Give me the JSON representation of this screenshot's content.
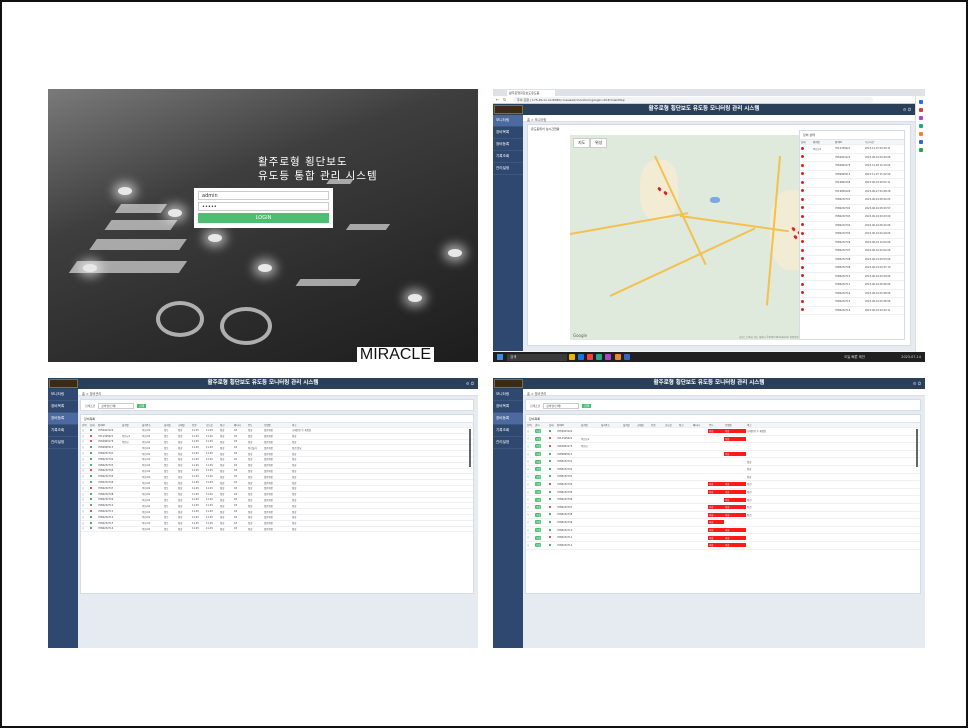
{
  "login": {
    "title_line1": "활주로형 횡단보도",
    "title_line2": "유도등 통합 관리 시스템",
    "username_value": "admin",
    "password_value": "•••••",
    "login_button": "LOGIN",
    "brand": "MIRACLE"
  },
  "app": {
    "title": "활주로형 횡단보도 유도등 모니터링 관리 시스템",
    "sidebar": [
      "모니터링",
      "장비목록",
      "장비등록",
      "기록조회",
      "관리설정"
    ]
  },
  "browser": {
    "tab_title": "활주로형횡단보도유도등",
    "url": "주의 요함 | 175.46.xx.xx:8080/crosswalk/monitoring/login.ctrl#/mainMap",
    "taskbar_search": "검색",
    "taskbar_weather": "오늘 빠른 제안",
    "taskbar_time": "2023-07-14",
    "map_tabs": [
      "지도",
      "위성"
    ],
    "map_card_title": "유도등위치 실시간현황",
    "google": "Google",
    "map_footer": "키보드 단축키  지도 데이터 ©2023 SK telecom  이용약관  지도 오류 신고",
    "status_title": "장비 상태",
    "status_headers": [
      "상태",
      "장비명",
      "장비ID",
      "수신시간"
    ],
    "status_rows": [
      {
        "color": "#d22",
        "name": "옥천교1",
        "id": "7012345621",
        "time": "2023-12-07 09:30:11"
      },
      {
        "color": "#d22",
        "name": "",
        "id": "7056923124",
        "time": "2023-06-19 09:44:06"
      },
      {
        "color": "#d22",
        "name": "",
        "id": "7084963175",
        "time": "2023-12-28 10:14:04"
      },
      {
        "color": "#d22",
        "name": "",
        "id": "7089965513",
        "time": "2023-11-07 15:22:09"
      },
      {
        "color": "#d22",
        "name": "",
        "id": "7019862106",
        "time": "2023-06-19 08:52:11"
      },
      {
        "color": "#d22",
        "name": "",
        "id": "7019856109",
        "time": "2023-06-27 09:48:28"
      },
      {
        "color": "#d22",
        "name": "",
        "id": "7086232701",
        "time": "2023-06-19 08:44:05"
      },
      {
        "color": "#d22",
        "name": "",
        "id": "7086232702",
        "time": "2023-06-19 08:43:57"
      },
      {
        "color": "#d22",
        "name": "",
        "id": "7086232703",
        "time": "2023-06-19 09:23:09"
      },
      {
        "color": "#d22",
        "name": "",
        "id": "7086232704",
        "time": "2023-06-19 08:44:06"
      },
      {
        "color": "#d22",
        "name": "",
        "id": "7086232705",
        "time": "2023-06-19 09:29:06"
      },
      {
        "color": "#d22",
        "name": "",
        "id": "7086232706",
        "time": "2023-06-19 10:04:06"
      },
      {
        "color": "#d22",
        "name": "",
        "id": "7086232707",
        "time": "2023-06-19 09:52:06"
      },
      {
        "color": "#d22",
        "name": "",
        "id": "7086232708",
        "time": "2023-06-19 09:53:06"
      },
      {
        "color": "#d22",
        "name": "",
        "id": "7086232709",
        "time": "2023-06-19 09:37:10"
      },
      {
        "color": "#d22",
        "name": "",
        "id": "7086232710",
        "time": "2023-06-19 09:49:06"
      },
      {
        "color": "#d22",
        "name": "",
        "id": "7086232711",
        "time": "2023-06-19 08:46:06"
      },
      {
        "color": "#d22",
        "name": "",
        "id": "7086232712",
        "time": "2023-06-19 09:48:06"
      },
      {
        "color": "#d22",
        "name": "",
        "id": "7086232713",
        "time": "2023-06-19 09:36:06"
      },
      {
        "color": "#d22",
        "name": "",
        "id": "7086232714",
        "time": "2023-06-19 09:44:11"
      }
    ]
  },
  "list": {
    "breadcrumb": "홈 > 장비관리",
    "search_label": "검색조건",
    "search_select": "장비명(전체)",
    "search_button": "검색",
    "card_title": "장비목록",
    "headers": [
      "선택",
      "상태",
      "장비ID",
      "설치명",
      "설치주소",
      "설치일",
      "교체일",
      "전원",
      "조도값",
      "통신",
      "배터리",
      "온도",
      "모델명",
      "비고"
    ],
    "rows": [
      [
        "",
        "#2a8d3c",
        "7056923124",
        "",
        "옥천-01",
        "점등",
        "정상",
        "11.0V",
        "11.0V",
        "정상",
        "18",
        "정상",
        "일반제품",
        "교체완료 후 재점검"
      ],
      [
        "",
        "#d22",
        "7012345621",
        "옥천교1",
        "옥천-01",
        "점등",
        "정상",
        "11.0V",
        "11.0V",
        "정상",
        "18",
        "정상",
        "일반제품",
        "정상"
      ],
      [
        "",
        "#d22",
        "7084963175",
        "옥천교",
        "옥천-01",
        "점등",
        "정상",
        "11.0V",
        "11.0V",
        "정상",
        "18",
        "정상",
        "일반제품",
        "정상"
      ],
      [
        "",
        "#2a8d3c",
        "7089965513",
        "",
        "옥천-01",
        "점등",
        "정상",
        "11.0V",
        "11.0V",
        "정상",
        "18",
        "통신불가",
        "일반제품",
        "점검 필요"
      ],
      [
        "",
        "#2a8d3c",
        "7086232701",
        "",
        "옥천-01",
        "점등",
        "정상",
        "11.0V",
        "11.0V",
        "정상",
        "18",
        "정상",
        "일반제품",
        "정상"
      ],
      [
        "",
        "#2a8d3c",
        "7086232702",
        "",
        "옥천-01",
        "점등",
        "정상",
        "11.0V",
        "11.0V",
        "정상",
        "18",
        "정상",
        "일반제품",
        "정상"
      ],
      [
        "",
        "#2a8d3c",
        "7086232703",
        "",
        "옥천-01",
        "점등",
        "정상",
        "11.0V",
        "11.0V",
        "정상",
        "18",
        "정상",
        "일반제품",
        "정상"
      ],
      [
        "",
        "#d22",
        "7086232704",
        "",
        "옥천-01",
        "점등",
        "정상",
        "11.0V",
        "11.0V",
        "정상",
        "18",
        "정상",
        "일반제품",
        "정상"
      ],
      [
        "",
        "#2a8d3c",
        "7086232705",
        "",
        "옥천-01",
        "점등",
        "정상",
        "11.0V",
        "11.0V",
        "정상",
        "18",
        "정상",
        "일반제품",
        "정상"
      ],
      [
        "",
        "#2a8d3c",
        "7086232706",
        "",
        "옥천-01",
        "점등",
        "정상",
        "11.0V",
        "11.0V",
        "정상",
        "18",
        "정상",
        "일반제품",
        "정상"
      ],
      [
        "",
        "#d22",
        "7086232707",
        "",
        "옥천-01",
        "점등",
        "정상",
        "11.0V",
        "11.0V",
        "정상",
        "18",
        "정상",
        "일반제품",
        "정상"
      ],
      [
        "",
        "#2a8d3c",
        "7086232708",
        "",
        "옥천-01",
        "점등",
        "정상",
        "11.0V",
        "11.0V",
        "정상",
        "18",
        "정상",
        "일반제품",
        "정상"
      ],
      [
        "",
        "#2a8d3c",
        "7086232709",
        "",
        "옥천-01",
        "점등",
        "정상",
        "11.0V",
        "11.0V",
        "정상",
        "18",
        "정상",
        "일반제품",
        "정상"
      ],
      [
        "",
        "#2a8d3c",
        "7086232710",
        "",
        "옥천-01",
        "점등",
        "정상",
        "11.0V",
        "11.0V",
        "정상",
        "18",
        "정상",
        "일반제품",
        "정상"
      ],
      [
        "",
        "#d22",
        "7086232711",
        "",
        "옥천-01",
        "점등",
        "정상",
        "11.0V",
        "11.0V",
        "정상",
        "18",
        "정상",
        "일반제품",
        "정상"
      ],
      [
        "",
        "#2a8d3c",
        "7086232712",
        "",
        "옥천-01",
        "점등",
        "정상",
        "11.0V",
        "11.0V",
        "정상",
        "18",
        "정상",
        "일반제품",
        "정상"
      ],
      [
        "",
        "#2a8d3c",
        "7086232713",
        "",
        "옥천-01",
        "점등",
        "정상",
        "11.0V",
        "11.0V",
        "정상",
        "18",
        "정상",
        "일반제품",
        "정상"
      ],
      [
        "",
        "#2a8d3c",
        "7086232714",
        "",
        "옥천-01",
        "점등",
        "정상",
        "11.0V",
        "11.0V",
        "정상",
        "18",
        "정상",
        "일반제품",
        "정상"
      ]
    ]
  },
  "list2": {
    "breadcrumb": "홈 > 장비관리",
    "search_label": "검색조건",
    "search_select": "장비명(전체)",
    "search_button": "검색",
    "card_title": "장비목록",
    "tag": "수정",
    "headers": [
      "선택",
      "관리",
      "상태",
      "장비ID",
      "설치명",
      "설치주소",
      "설치일",
      "교체일",
      "전원",
      "조도값",
      "통신",
      "배터리",
      "온도",
      "모델명",
      "비고"
    ],
    "rows": [
      {
        "color": "#2a8d3c",
        "id": "7056923124",
        "name": "",
        "r1": "이상",
        "r2": "이상",
        "note": "교체완료 후 재점검"
      },
      {
        "color": "#d22",
        "id": "7012345621",
        "name": "옥천교1",
        "r1": "",
        "r2": "이상",
        "note": ""
      },
      {
        "color": "#d22",
        "id": "7084963175",
        "name": "옥천교",
        "r1": "",
        "r2": "",
        "note": ""
      },
      {
        "color": "#2a8d3c",
        "id": "7089965513",
        "name": "",
        "r1": "",
        "r2": "이상",
        "note": ""
      },
      {
        "color": "#2a8d3c",
        "id": "7086232701",
        "name": "",
        "r1": "",
        "r2": "",
        "note": "정상"
      },
      {
        "color": "#2a8d3c",
        "id": "7086232702",
        "name": "",
        "r1": "",
        "r2": "",
        "note": "정상"
      },
      {
        "color": "#2a8d3c",
        "id": "7086232703",
        "name": "",
        "r1": "",
        "r2": "",
        "note": "정상"
      },
      {
        "color": "#d22",
        "id": "7086232704",
        "name": "",
        "r1": "이상",
        "r2": "이상",
        "note": "점검"
      },
      {
        "color": "#2a8d3c",
        "id": "7086232705",
        "name": "",
        "r1": "이상",
        "r2": "이상",
        "note": "점검"
      },
      {
        "color": "#2a8d3c",
        "id": "7086232706",
        "name": "",
        "r1": "",
        "r2": "이상",
        "note": "점검"
      },
      {
        "color": "#d22",
        "id": "7086232707",
        "name": "",
        "r1": "이상",
        "r2": "이상",
        "note": "점검"
      },
      {
        "color": "#2a8d3c",
        "id": "7086232708",
        "name": "",
        "r1": "이상",
        "r2": "이상",
        "note": "점검"
      },
      {
        "color": "#2a8d3c",
        "id": "7086232709",
        "name": "",
        "r1": "이상",
        "r2": "",
        "note": ""
      },
      {
        "color": "#2a8d3c",
        "id": "7086232710",
        "name": "",
        "r1": "이상",
        "r2": "이상",
        "note": ""
      },
      {
        "color": "#d22",
        "id": "7086232711",
        "name": "",
        "r1": "이상",
        "r2": "이상",
        "note": ""
      },
      {
        "color": "#2a8d3c",
        "id": "7086232712",
        "name": "",
        "r1": "이상",
        "r2": "이상",
        "note": ""
      }
    ]
  }
}
